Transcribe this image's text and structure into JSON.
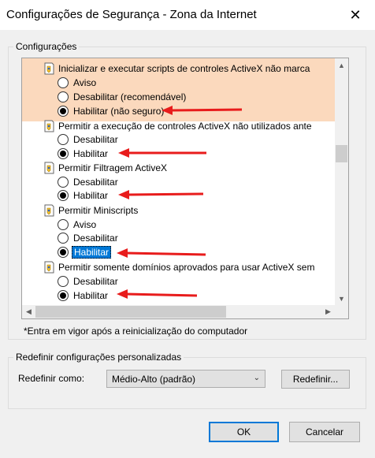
{
  "window": {
    "title": "Configurações de Segurança - Zona da Internet",
    "close_glyph": "✕"
  },
  "settings_group": {
    "label": "Configurações"
  },
  "settings": [
    {
      "title": "Inicializar e executar scripts de controles ActiveX não marca",
      "options": [
        {
          "label": "Aviso",
          "checked": false
        },
        {
          "label": "Desabilitar (recomendável)",
          "checked": false
        },
        {
          "label": "Habilitar (não seguro)",
          "checked": true
        }
      ]
    },
    {
      "title": "Permitir a execução de controles ActiveX não utilizados ante",
      "options": [
        {
          "label": "Desabilitar",
          "checked": false
        },
        {
          "label": "Habilitar",
          "checked": true
        }
      ]
    },
    {
      "title": "Permitir Filtragem ActiveX",
      "options": [
        {
          "label": "Desabilitar",
          "checked": false
        },
        {
          "label": "Habilitar",
          "checked": true
        }
      ]
    },
    {
      "title": "Permitir Miniscripts",
      "options": [
        {
          "label": "Aviso",
          "checked": false
        },
        {
          "label": "Desabilitar",
          "checked": false
        },
        {
          "label": "Habilitar",
          "checked": true,
          "focused": true
        }
      ]
    },
    {
      "title": "Permitir somente domínios aprovados para usar ActiveX sem",
      "options": [
        {
          "label": "Desabilitar",
          "checked": false
        },
        {
          "label": "Habilitar",
          "checked": true
        }
      ]
    }
  ],
  "note": "*Entra em vigor após a reinicialização do computador",
  "reset_group": {
    "label": "Redefinir configurações personalizadas",
    "reset_to_label": "Redefinir como:",
    "reset_value": "Médio-Alto (padrão)",
    "reset_button": "Redefinir..."
  },
  "buttons": {
    "ok": "OK",
    "cancel": "Cancelar"
  },
  "icons": {
    "setting": "shield-gear-icon",
    "scroll_up": "▲",
    "scroll_down": "▼",
    "scroll_left": "◀",
    "scroll_right": "▶",
    "dropdown": "⌄"
  },
  "colors": {
    "highlight_row": "#fbd9bd",
    "annotation_arrow": "#e81c1c",
    "selection": "#0078d7"
  }
}
